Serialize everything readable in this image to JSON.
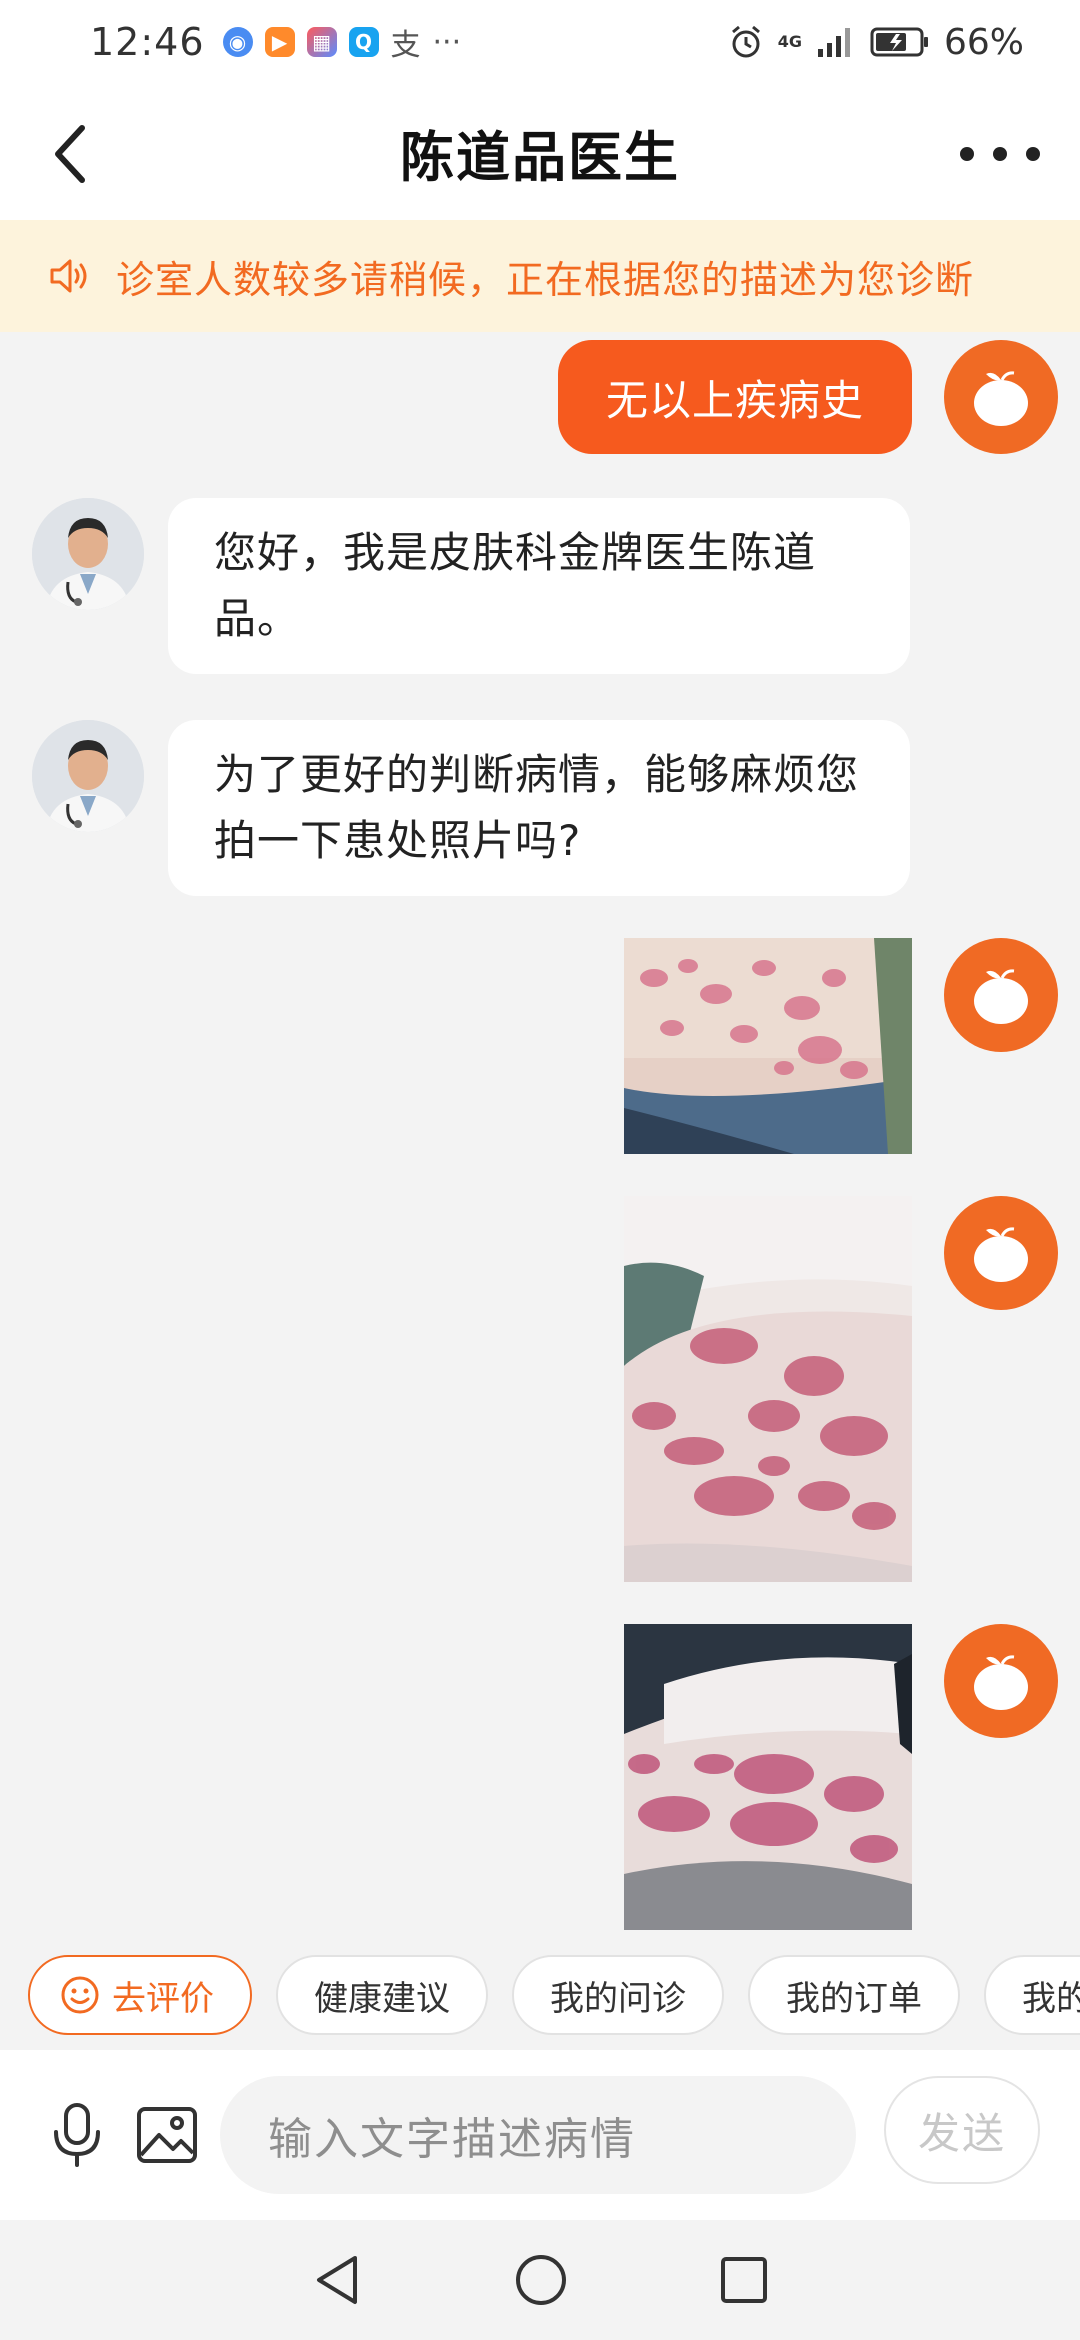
{
  "status_bar": {
    "time": "12:46",
    "notif_text": "支",
    "more": "···",
    "network": "4G",
    "battery": "66%"
  },
  "header": {
    "title": "陈道品医生"
  },
  "notice": {
    "text": "诊室人数较多请稍候，正在根据您的描述为您诊断"
  },
  "messages": {
    "user_text": "无以上疾病史",
    "doctor_1": "您好，我是皮肤科金牌医生陈道品。",
    "doctor_2": "为了更好的判断病情，能够麻烦您拍一下患处照片吗?"
  },
  "quick_actions": [
    {
      "label": "去评价"
    },
    {
      "label": "健康建议"
    },
    {
      "label": "我的问诊"
    },
    {
      "label": "我的订单"
    },
    {
      "label": "我的"
    }
  ],
  "input": {
    "placeholder": "输入文字描述病情",
    "send_label": "发送"
  },
  "colors": {
    "accent": "#f26a21",
    "user_bubble": "#f65a1e",
    "notice_bg": "#fdf3dc",
    "chat_bg": "#f3f3f3"
  }
}
